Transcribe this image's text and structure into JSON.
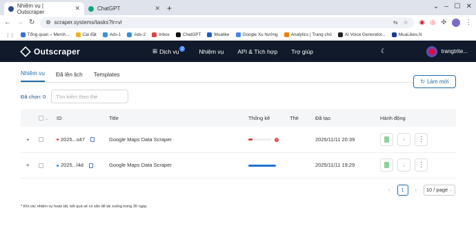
{
  "browser": {
    "tabs": [
      {
        "title": "Nhiệm vụ | Outscraper",
        "active": true,
        "color": "#2d4a8a"
      },
      {
        "title": "ChatGPT",
        "active": false,
        "color": "#10a37f"
      }
    ],
    "new_tab": "+",
    "url": "scraper.systems/tasks?lr=vi",
    "bookmarks": [
      {
        "label": "Tổng quan – Merch...",
        "color": "#3a6bd8"
      },
      {
        "label": "Cài đặt",
        "color": "#f2b21c"
      },
      {
        "label": "Ads-1",
        "color": "#3a8fd8"
      },
      {
        "label": "Ads-2",
        "color": "#3a8fd8"
      },
      {
        "label": "Inbox",
        "color": "#d44"
      },
      {
        "label": "ChatGPT",
        "color": "#111"
      },
      {
        "label": "Mualike",
        "color": "#1d5fbf"
      },
      {
        "label": "Google Xu hướng",
        "color": "#4285f4"
      },
      {
        "label": "Analytics | Trang chủ",
        "color": "#f57c00"
      },
      {
        "label": "AI Voice Generator...",
        "color": "#222"
      },
      {
        "label": "MuaLikes.N",
        "color": "#1a3e8c"
      }
    ]
  },
  "app": {
    "brand": "Outscraper",
    "nav": [
      {
        "label": "Dịch vụ",
        "badge": "2",
        "icon": "grid-icon"
      },
      {
        "label": "Nhiệm vụ"
      },
      {
        "label": "API & Tích hợp"
      },
      {
        "label": "Trợ giúp"
      }
    ],
    "username": "trangtrite..."
  },
  "page": {
    "tabs": [
      "Nhiệm vụ",
      "Đã lên lịch",
      "Templates"
    ],
    "new_button": "Làm mới",
    "selected_label": "Đã chọn: 0",
    "search_placeholder": "Tìm kiếm theo thẻ",
    "columns": [
      "ID",
      "Title",
      "Thống kê",
      "Thẻ",
      "Đã tạo",
      "Hành động"
    ],
    "rows": [
      {
        "expand": "+",
        "id": "2025...s47",
        "status_color": "#e53935",
        "title": "Google Maps Data Scraper",
        "stats": "failed",
        "stats_progress": 0.15,
        "tags": "",
        "created": "2025/11/11 20:39"
      },
      {
        "expand": "+",
        "id": "2025...l4d",
        "status_color": "#1e88e5",
        "title": "Google Maps Data Scraper",
        "stats": "completed",
        "stats_progress": 1.0,
        "tags": "",
        "created": "2025/11/11 19:29"
      }
    ],
    "pagination": {
      "prev": "‹",
      "current": "1",
      "next": "›",
      "per_page": "10 / page"
    },
    "footnote": "* Khi các nhiệm vụ hoàn tất, kết quả sẽ có sẵn để tải xuống trong 30 ngày"
  }
}
